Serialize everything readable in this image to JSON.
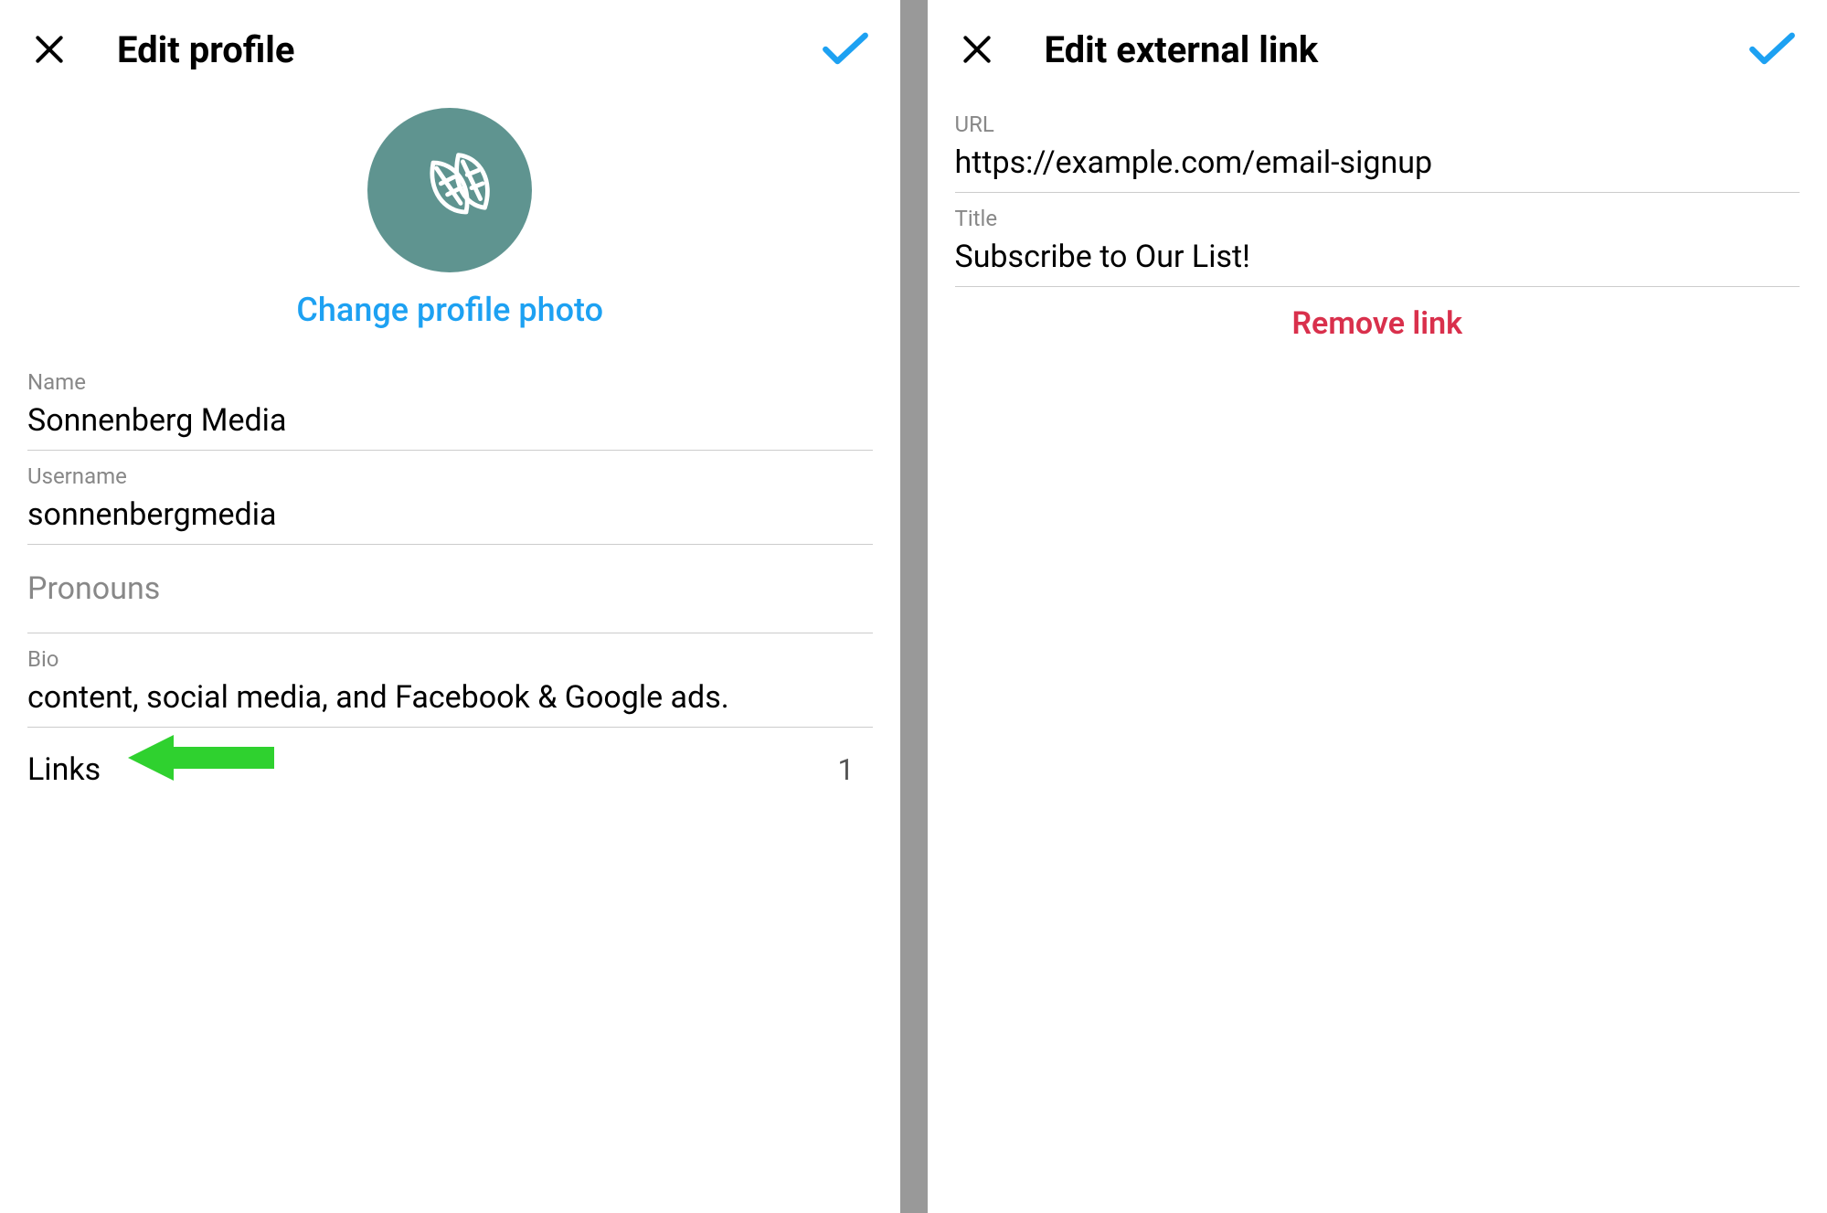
{
  "left": {
    "header_title": "Edit profile",
    "change_photo": "Change profile photo",
    "name_label": "Name",
    "name_value": "Sonnenberg Media",
    "username_label": "Username",
    "username_value": "sonnenbergmedia",
    "pronouns_label": "Pronouns",
    "bio_label": "Bio",
    "bio_value": "content, social media, and Facebook & Google ads.",
    "links_label": "Links",
    "links_count": "1"
  },
  "right": {
    "header_title": "Edit external link",
    "url_label": "URL",
    "url_value": "https://example.com/email-signup",
    "title_label": "Title",
    "title_value": "Subscribe to Our List!",
    "remove_link": "Remove link"
  },
  "colors": {
    "accent_blue": "#1da1f2",
    "danger_red": "#d9304c",
    "avatar_bg": "#5f9490",
    "annotation_green": "#2fd12f"
  }
}
